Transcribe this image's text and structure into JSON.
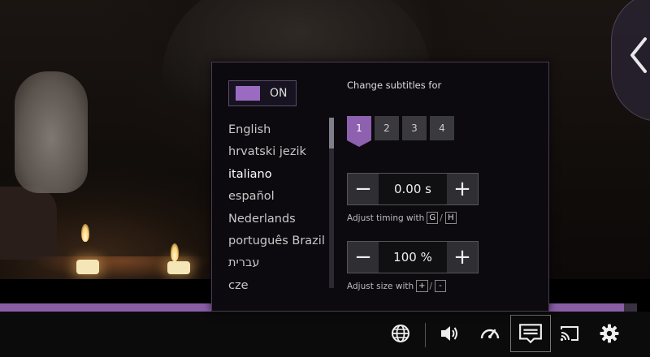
{
  "player": {
    "progress_fraction": 0.98
  },
  "subtitles_panel": {
    "toggle_label": "ON",
    "change_title": "Change subtitles for",
    "languages": [
      {
        "label": "English",
        "selected": false
      },
      {
        "label": "hrvatski jezik",
        "selected": false
      },
      {
        "label": "italiano",
        "selected": true
      },
      {
        "label": "español",
        "selected": false
      },
      {
        "label": "Nederlands",
        "selected": false
      },
      {
        "label": "português Brazil",
        "selected": false
      },
      {
        "label": "עברית",
        "selected": false
      },
      {
        "label": "cze",
        "selected": false
      }
    ],
    "tracks": [
      "1",
      "2",
      "3",
      "4"
    ],
    "active_track": "1",
    "timing": {
      "value": "0.00 s",
      "minus": "−",
      "plus": "+",
      "hint": "Adjust timing with",
      "key_1": "G",
      "key_2": "H",
      "sep": "/"
    },
    "size": {
      "value": "100 %",
      "minus": "−",
      "plus": "+",
      "hint": "Adjust size with",
      "key_1": "+",
      "key_2": "-",
      "sep": "/"
    }
  },
  "controls": {
    "icons": [
      "globe-icon",
      "volume-icon",
      "speedometer-icon",
      "subtitles-icon",
      "cast-icon",
      "settings-icon"
    ]
  },
  "colors": {
    "accent": "#8d60b0",
    "progress": "#8a5ea6"
  }
}
